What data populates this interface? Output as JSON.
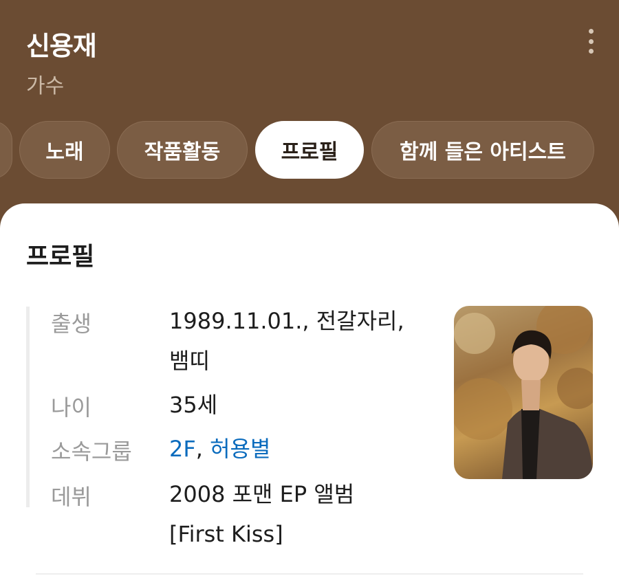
{
  "header": {
    "name": "신용재",
    "subtitle": "가수"
  },
  "tabs": [
    {
      "label": "노래",
      "active": false
    },
    {
      "label": "작품활동",
      "active": false
    },
    {
      "label": "프로필",
      "active": true
    },
    {
      "label": "함께 들은 아티스트",
      "active": false
    }
  ],
  "profile": {
    "title": "프로필",
    "rows": [
      {
        "label": "출생",
        "value": "1989.11.01., 전갈자리, 뱀띠"
      },
      {
        "label": "나이",
        "value": "35세"
      },
      {
        "label": "소속그룹",
        "links": [
          "2F",
          "허용별"
        ],
        "separator": ", "
      },
      {
        "label": "데뷔",
        "value": "2008 포맨 EP 앨범 [First Kiss]"
      }
    ]
  },
  "icons": {
    "more": "more-vertical-icon",
    "photo": "artist-photo"
  },
  "colors": {
    "header_bg": "#6b4c33",
    "tab_bg": "#7b5d44",
    "link": "#0a6bbd"
  }
}
